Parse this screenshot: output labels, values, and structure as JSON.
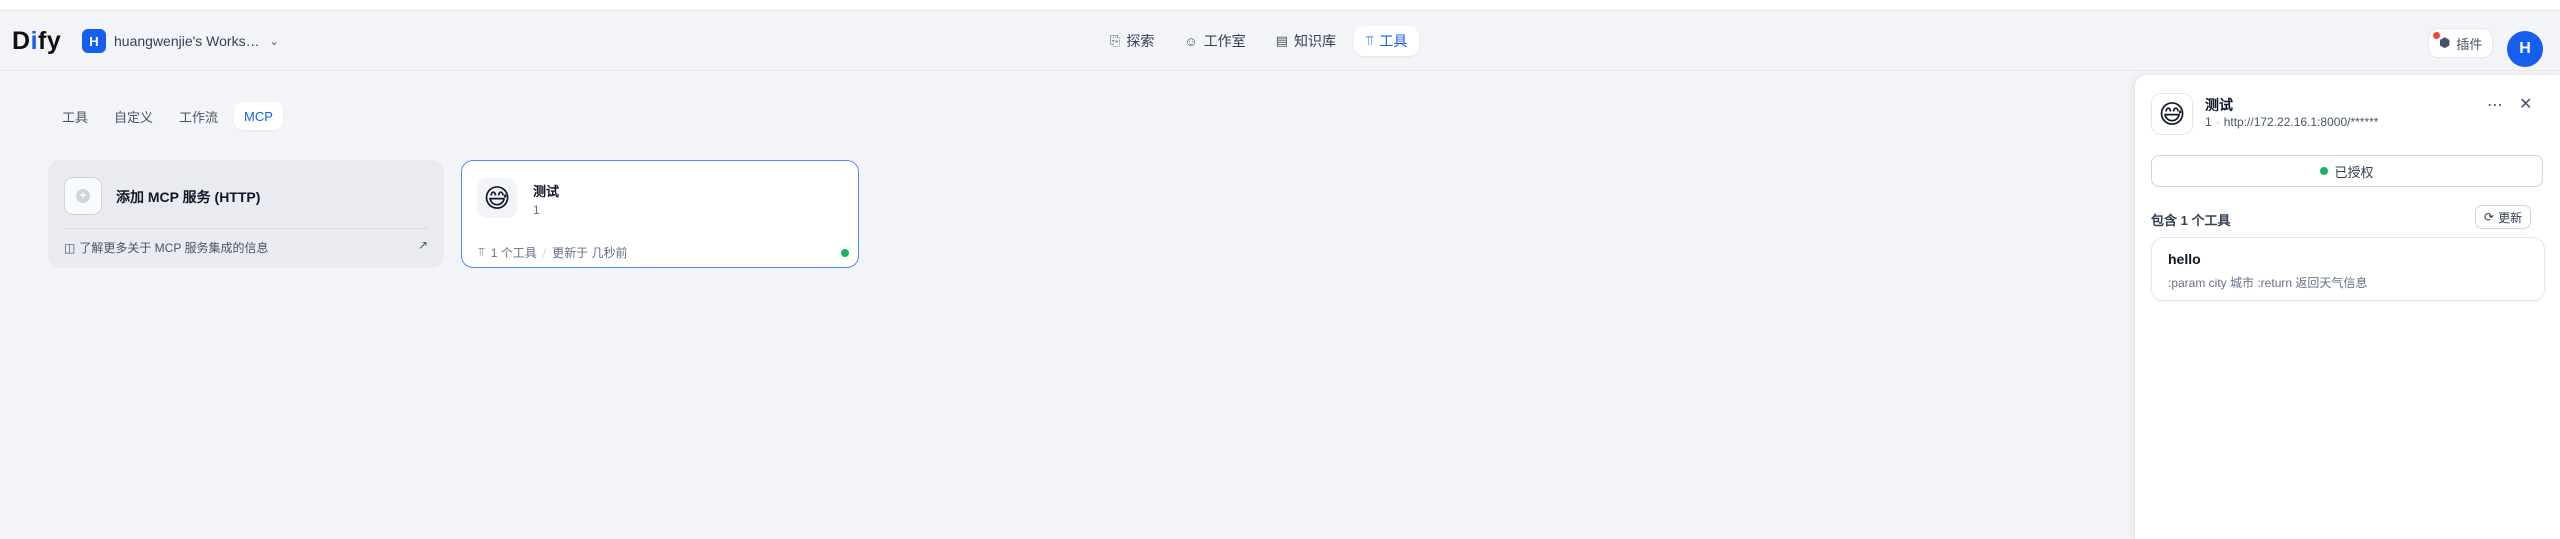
{
  "app": {
    "logo": {
      "pre": "D",
      "mid": "i",
      "post": "fy"
    },
    "workspace": {
      "initial": "H",
      "name": "huangwenjie's Works…"
    },
    "user_initial": "H",
    "plugin_label": "插件"
  },
  "nav": [
    {
      "label": "探索",
      "icon": "explore-icon"
    },
    {
      "label": "工作室",
      "icon": "robot-icon"
    },
    {
      "label": "知识库",
      "icon": "book-icon"
    },
    {
      "label": "工具",
      "icon": "tool-icon",
      "active": true
    }
  ],
  "tabs": [
    {
      "label": "工具"
    },
    {
      "label": "自定义"
    },
    {
      "label": "工作流"
    },
    {
      "label": "MCP",
      "active": true
    }
  ],
  "add_card": {
    "title": "添加 MCP 服务 (HTTP)",
    "learn_more": "了解更多关于 MCP 服务集成的信息"
  },
  "server_card": {
    "emoji": "😅",
    "name": "测试",
    "sub": "1",
    "tools_count": "1 个工具",
    "updated": "更新于 几秒前",
    "status_color": "#17b26a"
  },
  "panel": {
    "emoji": "😅",
    "title": "测试",
    "id": "1",
    "url": "http://172.22.16.1:8000/******",
    "auth_label": "已授权",
    "tools_count_label": "包含 1 个工具",
    "update_label": "更新",
    "tools": [
      {
        "name": "hello",
        "description": ":param city 城市 :return 返回天气信息"
      }
    ]
  },
  "colors": {
    "accent": "#155eef",
    "success": "#17b26a",
    "badge": "#f04438"
  }
}
